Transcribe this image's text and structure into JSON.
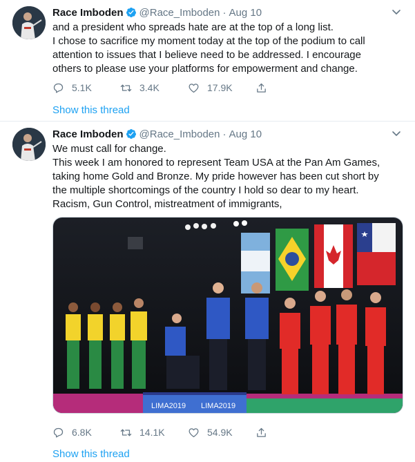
{
  "tweets": [
    {
      "name": "Race Imboden",
      "handle": "@Race_Imboden",
      "separator": "·",
      "date": "Aug 10",
      "lines": [
        "and a president who spreads hate are at the top of a long list.",
        "I chose to sacrifice my moment today at the top of the podium to call",
        "attention to issues that I believe need to be addressed.  I encourage",
        "others to please use your platforms for empowerment and change."
      ],
      "replies": "5.1K",
      "retweets": "3.4K",
      "likes": "17.9K",
      "show_thread": "Show this thread"
    },
    {
      "name": "Race Imboden",
      "handle": "@Race_Imboden",
      "separator": "·",
      "date": "Aug 10",
      "lines": [
        "We must call for change.",
        "This week I am honored to represent Team USA at the Pan Am Games,",
        "taking home Gold and Bronze. My pride however has been cut short by",
        "the multiple shortcomings of the country I hold so dear to my heart.",
        "Racism, Gun Control, mistreatment of immigrants,"
      ],
      "media": {
        "banner_left": "LIMA2019",
        "banner_right": "LIMA2019"
      },
      "replies": "6.8K",
      "retweets": "14.1K",
      "likes": "54.9K",
      "show_thread": "Show this thread"
    }
  ],
  "colors": {
    "accent": "#1da1f2",
    "secondary_text": "#657786",
    "primary_text": "#14171a",
    "divider": "#e6ecf0"
  },
  "icons": {
    "reply": "speech-bubble-icon",
    "retweet": "retweet-icon",
    "like": "heart-icon",
    "share": "share-icon",
    "verified": "verified-badge-icon",
    "more": "chevron-down-icon"
  }
}
